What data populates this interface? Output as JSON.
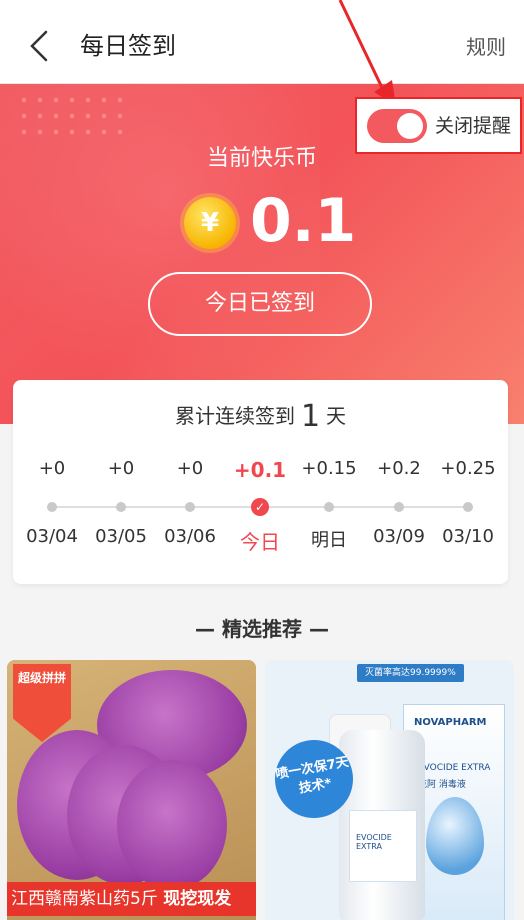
{
  "header": {
    "title": "每日签到",
    "rules_label": "规则"
  },
  "reminder": {
    "label": "关闭提醒",
    "enabled": true
  },
  "balance": {
    "title": "当前快乐币",
    "coin_symbol": "¥",
    "value": "0.1"
  },
  "signin_button": {
    "label": "今日已签到"
  },
  "streak": {
    "prefix": "累计连续签到",
    "days": "1",
    "suffix": "天"
  },
  "calendar": {
    "rewards": [
      "+0",
      "+0",
      "+0",
      "+0.1",
      "+0.15",
      "+0.2",
      "+0.25"
    ],
    "dates": [
      "03/04",
      "03/05",
      "03/06",
      "今日",
      "明日",
      "03/09",
      "03/10"
    ],
    "today_index": 3
  },
  "section_title": "— 精选推荐 —",
  "products": [
    {
      "caption": "江西赣南紫山药5斤",
      "tag": "现挖现发",
      "badge": "超级拼拼"
    },
    {
      "stamp": "灭菌率高达99.9999%",
      "brand": "NOVAPHARM",
      "name": "EVOCIDE EXTRA",
      "sub": "克阿 消毒液",
      "bubble": "喷一次保7天技术*"
    }
  ],
  "colors": {
    "accent": "#f0484e",
    "hero_start": "#f25d64",
    "hero_end": "#f8806e"
  }
}
